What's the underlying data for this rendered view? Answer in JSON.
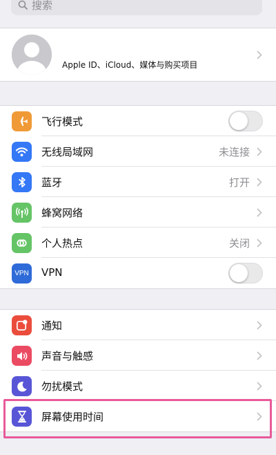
{
  "search": {
    "placeholder": "搜索"
  },
  "profile": {
    "label": "Apple ID、iCloud、媒体与购买项目"
  },
  "group1": [
    {
      "name": "airplane",
      "label": "飞行模式",
      "icon": "airplane-icon",
      "color": "#f09a37",
      "toggle": true,
      "toggle_on": false
    },
    {
      "name": "wifi",
      "label": "无线局域网",
      "icon": "wifi-icon",
      "color": "#3478f6",
      "value": "未连接"
    },
    {
      "name": "bluetooth",
      "label": "蓝牙",
      "icon": "bluetooth-icon",
      "color": "#3478f6",
      "value": "打开"
    },
    {
      "name": "cellular",
      "label": "蜂窝网络",
      "icon": "cellular-icon",
      "color": "#65c466"
    },
    {
      "name": "hotspot",
      "label": "个人热点",
      "icon": "hotspot-icon",
      "color": "#65c466",
      "value": "关闭"
    },
    {
      "name": "vpn",
      "label": "VPN",
      "icon": "vpn-icon",
      "icon_text": "VPN",
      "color": "#2f6bd8",
      "toggle": true,
      "toggle_on": false
    }
  ],
  "group2": [
    {
      "name": "notifications",
      "label": "通知",
      "icon": "notifications-icon",
      "color": "#eb4d3d"
    },
    {
      "name": "sounds",
      "label": "声音与触感",
      "icon": "speaker-icon",
      "color": "#eb4b62"
    },
    {
      "name": "dnd",
      "label": "勿扰模式",
      "icon": "moon-icon",
      "color": "#5856d6"
    },
    {
      "name": "screen-time",
      "label": "屏幕使用时间",
      "icon": "hourglass-icon",
      "color": "#5856d6"
    }
  ],
  "colors": {
    "highlight": "#e85a9a",
    "background": "#efeff4"
  }
}
